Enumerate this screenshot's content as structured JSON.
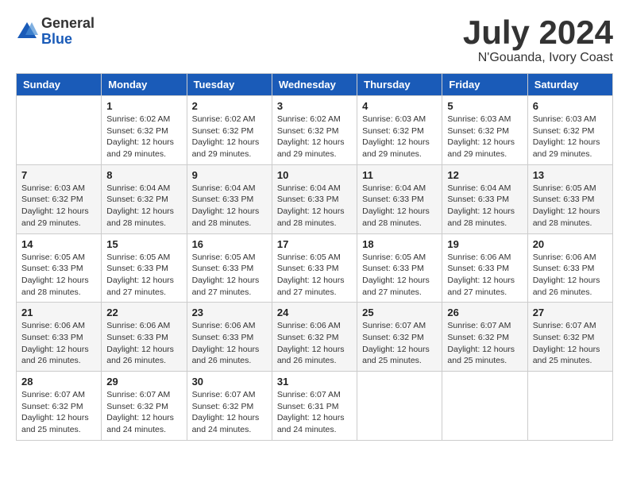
{
  "logo": {
    "general": "General",
    "blue": "Blue"
  },
  "header": {
    "month": "July 2024",
    "location": "N'Gouanda, Ivory Coast"
  },
  "weekdays": [
    "Sunday",
    "Monday",
    "Tuesday",
    "Wednesday",
    "Thursday",
    "Friday",
    "Saturday"
  ],
  "weeks": [
    [
      {
        "day": "",
        "info": ""
      },
      {
        "day": "1",
        "info": "Sunrise: 6:02 AM\nSunset: 6:32 PM\nDaylight: 12 hours\nand 29 minutes."
      },
      {
        "day": "2",
        "info": "Sunrise: 6:02 AM\nSunset: 6:32 PM\nDaylight: 12 hours\nand 29 minutes."
      },
      {
        "day": "3",
        "info": "Sunrise: 6:02 AM\nSunset: 6:32 PM\nDaylight: 12 hours\nand 29 minutes."
      },
      {
        "day": "4",
        "info": "Sunrise: 6:03 AM\nSunset: 6:32 PM\nDaylight: 12 hours\nand 29 minutes."
      },
      {
        "day": "5",
        "info": "Sunrise: 6:03 AM\nSunset: 6:32 PM\nDaylight: 12 hours\nand 29 minutes."
      },
      {
        "day": "6",
        "info": "Sunrise: 6:03 AM\nSunset: 6:32 PM\nDaylight: 12 hours\nand 29 minutes."
      }
    ],
    [
      {
        "day": "7",
        "info": "Sunrise: 6:03 AM\nSunset: 6:32 PM\nDaylight: 12 hours\nand 29 minutes."
      },
      {
        "day": "8",
        "info": "Sunrise: 6:04 AM\nSunset: 6:32 PM\nDaylight: 12 hours\nand 28 minutes."
      },
      {
        "day": "9",
        "info": "Sunrise: 6:04 AM\nSunset: 6:33 PM\nDaylight: 12 hours\nand 28 minutes."
      },
      {
        "day": "10",
        "info": "Sunrise: 6:04 AM\nSunset: 6:33 PM\nDaylight: 12 hours\nand 28 minutes."
      },
      {
        "day": "11",
        "info": "Sunrise: 6:04 AM\nSunset: 6:33 PM\nDaylight: 12 hours\nand 28 minutes."
      },
      {
        "day": "12",
        "info": "Sunrise: 6:04 AM\nSunset: 6:33 PM\nDaylight: 12 hours\nand 28 minutes."
      },
      {
        "day": "13",
        "info": "Sunrise: 6:05 AM\nSunset: 6:33 PM\nDaylight: 12 hours\nand 28 minutes."
      }
    ],
    [
      {
        "day": "14",
        "info": "Sunrise: 6:05 AM\nSunset: 6:33 PM\nDaylight: 12 hours\nand 28 minutes."
      },
      {
        "day": "15",
        "info": "Sunrise: 6:05 AM\nSunset: 6:33 PM\nDaylight: 12 hours\nand 27 minutes."
      },
      {
        "day": "16",
        "info": "Sunrise: 6:05 AM\nSunset: 6:33 PM\nDaylight: 12 hours\nand 27 minutes."
      },
      {
        "day": "17",
        "info": "Sunrise: 6:05 AM\nSunset: 6:33 PM\nDaylight: 12 hours\nand 27 minutes."
      },
      {
        "day": "18",
        "info": "Sunrise: 6:05 AM\nSunset: 6:33 PM\nDaylight: 12 hours\nand 27 minutes."
      },
      {
        "day": "19",
        "info": "Sunrise: 6:06 AM\nSunset: 6:33 PM\nDaylight: 12 hours\nand 27 minutes."
      },
      {
        "day": "20",
        "info": "Sunrise: 6:06 AM\nSunset: 6:33 PM\nDaylight: 12 hours\nand 26 minutes."
      }
    ],
    [
      {
        "day": "21",
        "info": "Sunrise: 6:06 AM\nSunset: 6:33 PM\nDaylight: 12 hours\nand 26 minutes."
      },
      {
        "day": "22",
        "info": "Sunrise: 6:06 AM\nSunset: 6:33 PM\nDaylight: 12 hours\nand 26 minutes."
      },
      {
        "day": "23",
        "info": "Sunrise: 6:06 AM\nSunset: 6:33 PM\nDaylight: 12 hours\nand 26 minutes."
      },
      {
        "day": "24",
        "info": "Sunrise: 6:06 AM\nSunset: 6:32 PM\nDaylight: 12 hours\nand 26 minutes."
      },
      {
        "day": "25",
        "info": "Sunrise: 6:07 AM\nSunset: 6:32 PM\nDaylight: 12 hours\nand 25 minutes."
      },
      {
        "day": "26",
        "info": "Sunrise: 6:07 AM\nSunset: 6:32 PM\nDaylight: 12 hours\nand 25 minutes."
      },
      {
        "day": "27",
        "info": "Sunrise: 6:07 AM\nSunset: 6:32 PM\nDaylight: 12 hours\nand 25 minutes."
      }
    ],
    [
      {
        "day": "28",
        "info": "Sunrise: 6:07 AM\nSunset: 6:32 PM\nDaylight: 12 hours\nand 25 minutes."
      },
      {
        "day": "29",
        "info": "Sunrise: 6:07 AM\nSunset: 6:32 PM\nDaylight: 12 hours\nand 24 minutes."
      },
      {
        "day": "30",
        "info": "Sunrise: 6:07 AM\nSunset: 6:32 PM\nDaylight: 12 hours\nand 24 minutes."
      },
      {
        "day": "31",
        "info": "Sunrise: 6:07 AM\nSunset: 6:31 PM\nDaylight: 12 hours\nand 24 minutes."
      },
      {
        "day": "",
        "info": ""
      },
      {
        "day": "",
        "info": ""
      },
      {
        "day": "",
        "info": ""
      }
    ]
  ]
}
